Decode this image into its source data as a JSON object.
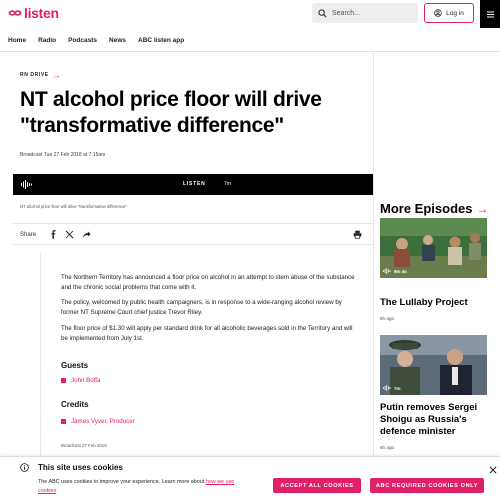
{
  "header": {
    "logo_text": "listen",
    "search_placeholder": "Search...",
    "login_label": "Log in"
  },
  "nav": {
    "items": [
      "Home",
      "Radio",
      "Podcasts",
      "News",
      "ABC listen app"
    ]
  },
  "article": {
    "eyebrow": "RN DRIVE",
    "title": "NT alcohol price floor will drive \"transformative difference\"",
    "broadcast_date": "Broadcast Tue 27 Feb 2018 at 7:15am",
    "player": {
      "listen_label": "LISTEN",
      "duration": "7m"
    },
    "caption": "NT alcohol price floor will drive \"transformative difference\"",
    "share_label": "Share",
    "paragraphs": [
      "The Northern Territory has announced a floor price on alcohol in an attempt to stem abuse of the substance and the chronic social problems that come with it.",
      "The policy, welcomed by public health campaigners, is in response to a wide-ranging alcohol review by former NT Supreme Court chief justice Trevor Riley.",
      "The floor price of $1.30 will apply per standard drink for all alcoholic beverages sold in the Territory and will be implemented from July 1st."
    ],
    "guests_heading": "Guests",
    "guests": [
      "John Boffa"
    ],
    "credits_heading": "Credits",
    "credits": [
      "James Vyver, Producer"
    ],
    "footer_broadcast": "Broadcast 27 Feb 2018"
  },
  "sidebar": {
    "heading": "More Episodes",
    "episodes": [
      {
        "title": "The Lullaby Project",
        "age": "6h ago",
        "duration": "9m 4s"
      },
      {
        "title": "Putin removes Sergei Shoigu as Russia's defence minister",
        "age": "6h ago",
        "duration": "7m"
      }
    ]
  },
  "cookie": {
    "title": "This site uses cookies",
    "text": "The ABC uses cookies to improve your experience. Learn more about",
    "link_text": "how we use cookies",
    "accept_all": "ACCEPT ALL COOKIES",
    "required_only": "ABC REQUIRED COOKIES ONLY"
  },
  "colors": {
    "accent": "#e2206a",
    "player_bg": "#000000"
  }
}
